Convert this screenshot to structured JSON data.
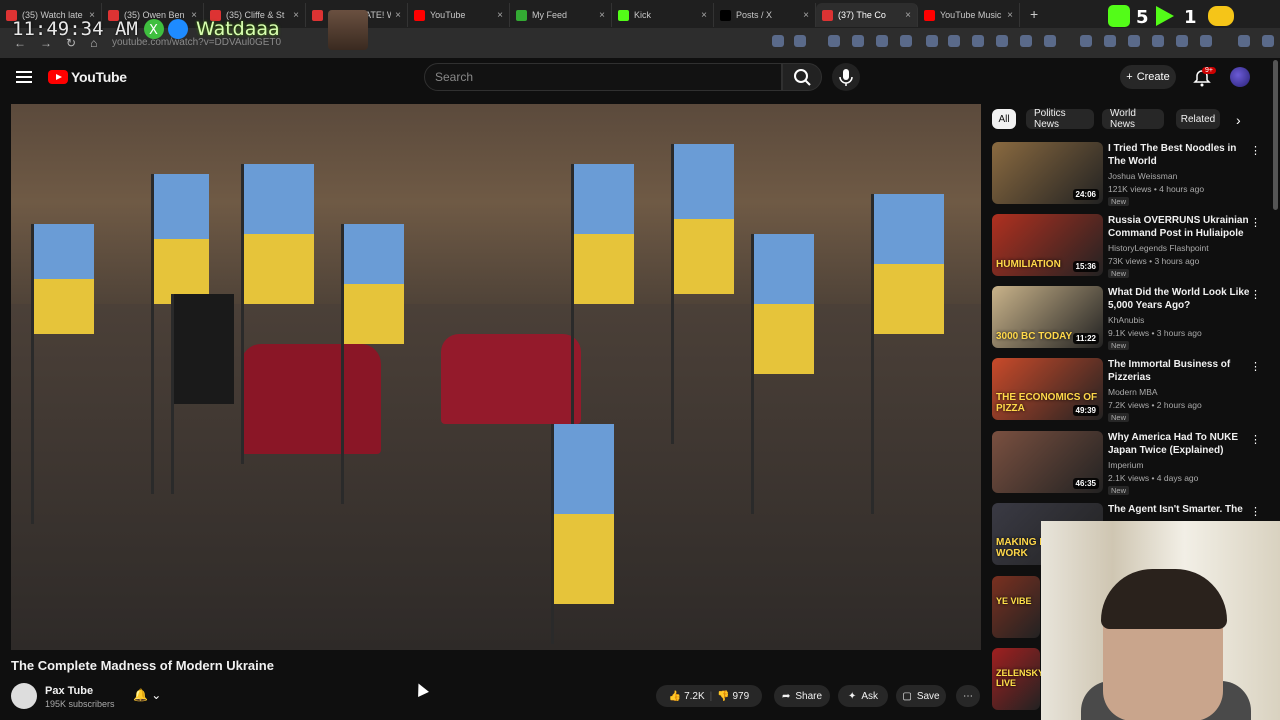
{
  "browser": {
    "tabs": [
      {
        "label": "(35) Watch late",
        "fav": "#d33"
      },
      {
        "label": "(35) Owen Ben",
        "fav": "#d33"
      },
      {
        "label": "(35) Cliffe & St",
        "fav": "#d33"
      },
      {
        "label": "(35) DEBATE! W",
        "fav": "#d33"
      },
      {
        "label": "YouTube",
        "fav": "#f00"
      },
      {
        "label": "My Feed",
        "fav": "#3a3"
      },
      {
        "label": "Kick",
        "fav": "#53fc18"
      },
      {
        "label": "Posts / X",
        "fav": "#000"
      },
      {
        "label": "(37) The Co",
        "fav": "#d33",
        "active": true
      },
      {
        "label": "YouTube Music",
        "fav": "#f00"
      }
    ],
    "url": "youtube.com/watch?v=DDVAul0GET0",
    "new_tab": "+"
  },
  "overlay": {
    "clock": "11:49:34 AM",
    "name": "Watdaaa",
    "counters": "5 1"
  },
  "header": {
    "logo_text": "YouTube",
    "search_placeholder": "Search",
    "create_label": "Create",
    "notif_count": "9+"
  },
  "video": {
    "title": "The Complete Madness of Modern Ukraine",
    "channel": "Pax Tube",
    "subscribers": "195K subscribers",
    "likes": "7.2K",
    "dislikes": "979",
    "share": "Share",
    "ask": "Ask",
    "save": "Save"
  },
  "chips": [
    "All",
    "Politics News",
    "World News",
    "Related"
  ],
  "recs": [
    {
      "title": "I Tried The Best Noodles in The World",
      "channel": "Joshua Weissman",
      "meta": "121K views • 4 hours ago",
      "duration": "24:06",
      "new": "New",
      "bg": "#8a6a40"
    },
    {
      "title": "Russia OVERRUNS Ukrainian Command Post in Huliaipole",
      "channel": "HistoryLegends Flashpoint",
      "meta": "73K views • 3 hours ago",
      "duration": "15:36",
      "new": "New",
      "bg": "#b03020",
      "overlay": "HUMILIATION"
    },
    {
      "title": "What Did the World Look Like 5,000 Years Ago?",
      "channel": "KhAnubis",
      "meta": "9.1K views • 3 hours ago",
      "duration": "11:22",
      "new": "New",
      "bg": "#c9b38a",
      "overlay": "3000 BC  TODAY"
    },
    {
      "title": "The Immortal Business of Pizzerias",
      "channel": "Modern MBA",
      "meta": "7.2K views • 2 hours ago",
      "duration": "49:39",
      "new": "New",
      "bg": "#c94a2a",
      "overlay": "THE ECONOMICS OF PIZZA"
    },
    {
      "title": "Why America Had To NUKE Japan Twice (Explained)",
      "channel": "Imperium",
      "meta": "2.1K views • 4 days ago",
      "duration": "46:35",
      "new": "New",
      "bg": "#7a5040"
    },
    {
      "title": "The Agent Isn't Smarter. The",
      "channel": "",
      "meta": "",
      "duration": "",
      "new": "",
      "bg": "#3a3a44",
      "overlay": "MAKING HOOKS WORK"
    }
  ],
  "mini_thumbs": [
    {
      "label": "YE VIBE",
      "bg": "#7a3020"
    },
    {
      "label": "ZELENSKY LIVE",
      "bg": "#a02020"
    }
  ]
}
